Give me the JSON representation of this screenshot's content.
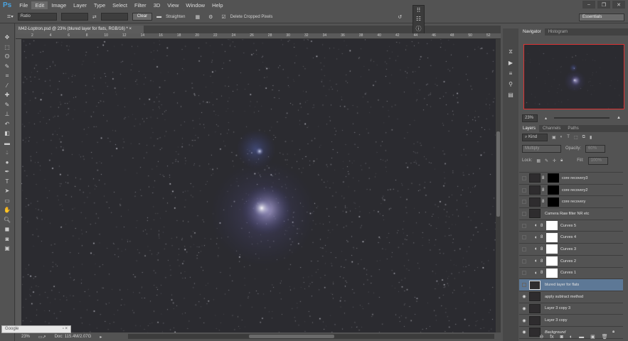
{
  "app": {
    "logo": "Ps"
  },
  "menu": [
    "File",
    "Edit",
    "Image",
    "Layer",
    "Type",
    "Select",
    "Filter",
    "3D",
    "View",
    "Window",
    "Help"
  ],
  "menu_active": "Edit",
  "options": {
    "ratio": "Ratio",
    "width": "",
    "height": "",
    "clear": "Clear",
    "straighten": "Straighten",
    "delete_cropped": "Delete Cropped Pixels",
    "workspace": "Essentials"
  },
  "document": {
    "tab": "M42-Loptron.psd @ 23% (blured layer for flats, RGB/16) *",
    "ruler_marks": [
      "2",
      "4",
      "6",
      "8",
      "10",
      "12",
      "14",
      "16",
      "18",
      "20",
      "22",
      "24",
      "26",
      "28",
      "30",
      "32",
      "34",
      "36",
      "38",
      "40",
      "42",
      "44",
      "46",
      "48",
      "50",
      "52"
    ]
  },
  "status": {
    "zoom": "23%",
    "doc": "Doc: 115.4M/2.07G"
  },
  "google": {
    "label": "Google"
  },
  "navigator": {
    "tabs": [
      "Navigator",
      "Histogram"
    ],
    "zoom": "23%"
  },
  "layers_panel": {
    "tabs": [
      "Layers",
      "Channels",
      "Paths"
    ],
    "kind": "Kind",
    "blend": "Multiply",
    "opacity_label": "Opacity:",
    "opacity": "60%",
    "lock_label": "Lock:",
    "fill_label": "Fill:",
    "fill": "100%",
    "layers": [
      {
        "name": "core recovery3",
        "visible": false,
        "type": "mask"
      },
      {
        "name": "core recovery2",
        "visible": false,
        "type": "mask"
      },
      {
        "name": "core recovery",
        "visible": false,
        "type": "mask"
      },
      {
        "name": "Camera Raw filter NR etc",
        "visible": false,
        "type": "pixel"
      },
      {
        "name": "Curves 5",
        "visible": false,
        "type": "curves"
      },
      {
        "name": "Curves 4",
        "visible": false,
        "type": "curves"
      },
      {
        "name": "Curves 3",
        "visible": false,
        "type": "curves"
      },
      {
        "name": "Curves 2",
        "visible": false,
        "type": "curves"
      },
      {
        "name": "Curves 1",
        "visible": false,
        "type": "curves"
      },
      {
        "name": "blured layer for flats",
        "visible": false,
        "type": "pixel",
        "selected": true
      },
      {
        "name": "apply subtract method",
        "visible": true,
        "type": "pixel"
      },
      {
        "name": "Layer 3 copy 3",
        "visible": true,
        "type": "pixel"
      },
      {
        "name": "Layer 3 copy",
        "visible": true,
        "type": "pixel"
      },
      {
        "name": "Background",
        "visible": true,
        "type": "pixel",
        "locked": true
      }
    ]
  },
  "colors": {
    "accent": "#4aa3df",
    "selection": "#5d7896",
    "navigator_frame": "#dd3333"
  }
}
